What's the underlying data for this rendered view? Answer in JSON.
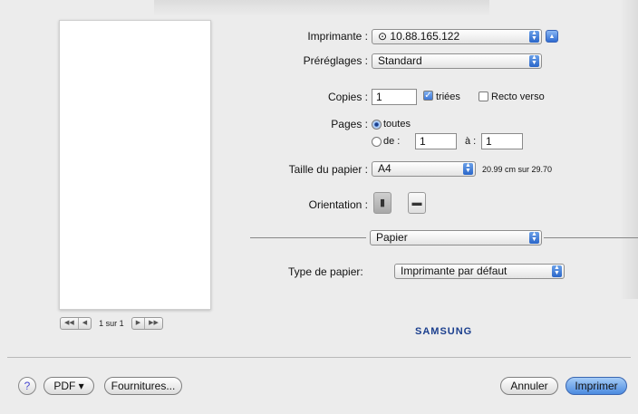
{
  "printer": {
    "label": "Imprimante :",
    "value": "10.88.165.122"
  },
  "presets": {
    "label": "Préréglages :",
    "value": "Standard"
  },
  "copies": {
    "label": "Copies :",
    "value": "1",
    "collated_label": "triées",
    "collated": true,
    "duplex_label": "Recto verso",
    "duplex": false
  },
  "pages": {
    "label": "Pages :",
    "all_label": "toutes",
    "from_label": "de :",
    "from_value": "1",
    "to_label": "à :",
    "to_value": "1"
  },
  "paper_size": {
    "label": "Taille du papier :",
    "value": "A4",
    "dimensions": "20.99 cm sur 29.70"
  },
  "orientation": {
    "label": "Orientation :"
  },
  "section": {
    "value": "Papier"
  },
  "paper_type": {
    "label": "Type de papier:",
    "value": "Imprimante par défaut"
  },
  "pager": {
    "first": "◀◀",
    "prev": "◀",
    "text": "1 sur 1",
    "next": "▶",
    "last": "▶▶"
  },
  "brand": "SAMSUNG",
  "buttons": {
    "help": "?",
    "pdf": "PDF ▾",
    "supplies": "Fournitures...",
    "cancel": "Annuler",
    "print": "Imprimer"
  }
}
